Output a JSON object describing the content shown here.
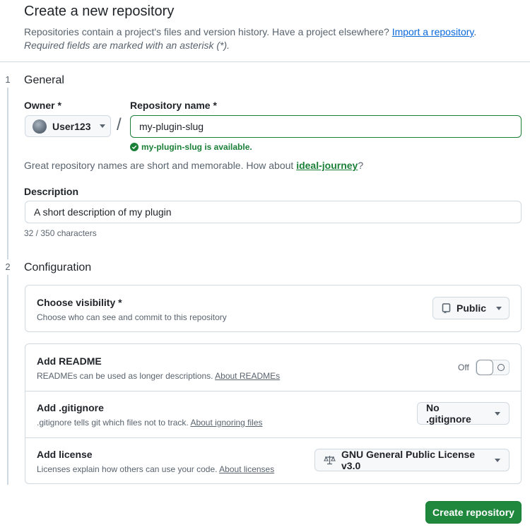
{
  "header": {
    "title": "Create a new repository",
    "intro_text": "Repositories contain a project's files and version history. Have a project elsewhere?",
    "import_link": "Import a repository",
    "intro_end": ".",
    "required_note": "Required fields are marked with an asterisk (*)."
  },
  "general": {
    "step": "1",
    "title": "General",
    "owner_label": "Owner *",
    "owner_value": "User123",
    "slash": "/",
    "repo_label": "Repository name *",
    "repo_value": "my-plugin-slug",
    "availability": "my-plugin-slug is available.",
    "suggest_text": "Great repository names are short and memorable. How about",
    "suggest_link": "ideal-journey",
    "suggest_end": "?",
    "description_label": "Description",
    "description_value": "A short description of my plugin",
    "char_count": "32 / 350 characters"
  },
  "configuration": {
    "step": "2",
    "title": "Configuration",
    "visibility": {
      "title": "Choose visibility *",
      "subtitle": "Choose who can see and commit to this repository",
      "value": "Public",
      "icon": "repo-icon"
    },
    "readme": {
      "title": "Add README",
      "subtitle": "READMEs can be used as longer descriptions.",
      "link": "About READMEs",
      "toggle_label": "Off",
      "toggle_state": false
    },
    "gitignore": {
      "title": "Add .gitignore",
      "subtitle": ".gitignore tells git which files not to track.",
      "link": "About ignoring files",
      "value": "No .gitignore"
    },
    "license": {
      "title": "Add license",
      "subtitle": "Licenses explain how others can use your code.",
      "link": "About licenses",
      "value": "GNU General Public License v3.0",
      "icon": "law-icon"
    }
  },
  "actions": {
    "create_label": "Create repository"
  },
  "colors": {
    "accent_green": "#1f883d",
    "link_blue": "#0969da",
    "border": "#d1d9e0"
  }
}
